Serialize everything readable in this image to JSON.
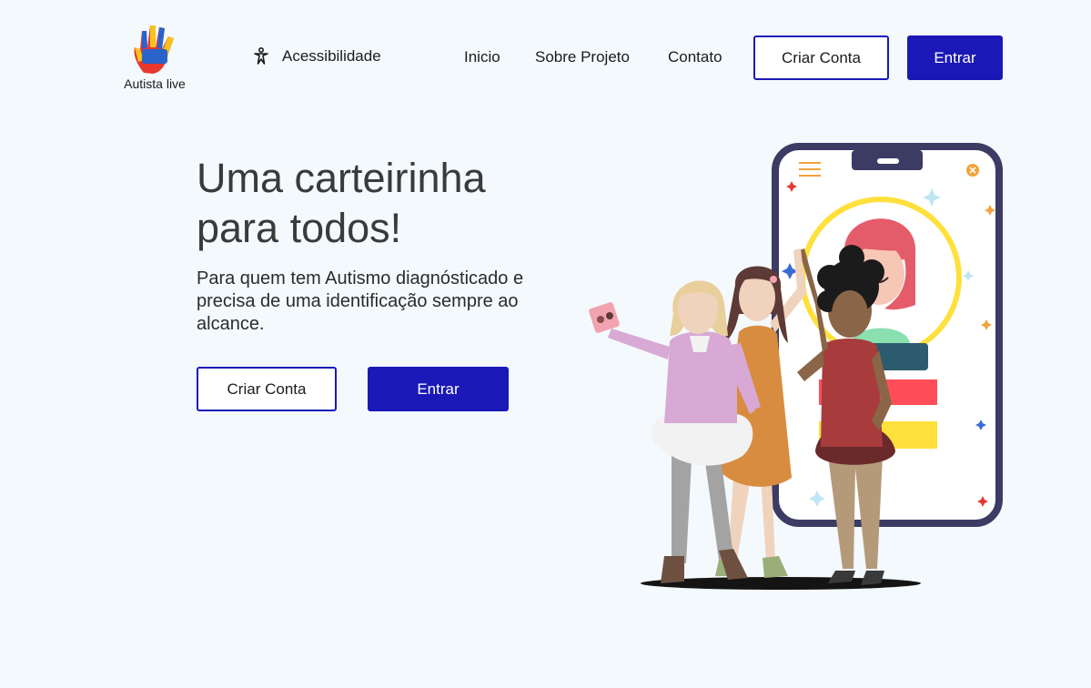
{
  "brand": {
    "name": "Autista live",
    "logo_text": "Autista live"
  },
  "header": {
    "accessibility_label": "Acessibilidade",
    "nav": {
      "inicio": "Inicio",
      "sobre": "Sobre Projeto",
      "contato": "Contato"
    },
    "create_account_label": "Criar Conta",
    "login_label": "Entrar"
  },
  "hero": {
    "title": "Uma carteirinha para todos!",
    "subtitle": "Para quem tem Autismo diagnósticado e precisa de uma identificação sempre ao alcance.",
    "create_account_label": "Criar Conta",
    "login_label": "Entrar"
  },
  "colors": {
    "primary": "#1a18b6",
    "background": "#f4f9fd",
    "phone_frame": "#3b3b64",
    "card_red": "#ff4d5a",
    "card_yellow": "#ffe03c"
  },
  "icons": {
    "accessibility": "accessibility-icon",
    "menu": "menu-icon",
    "close": "close-icon"
  }
}
